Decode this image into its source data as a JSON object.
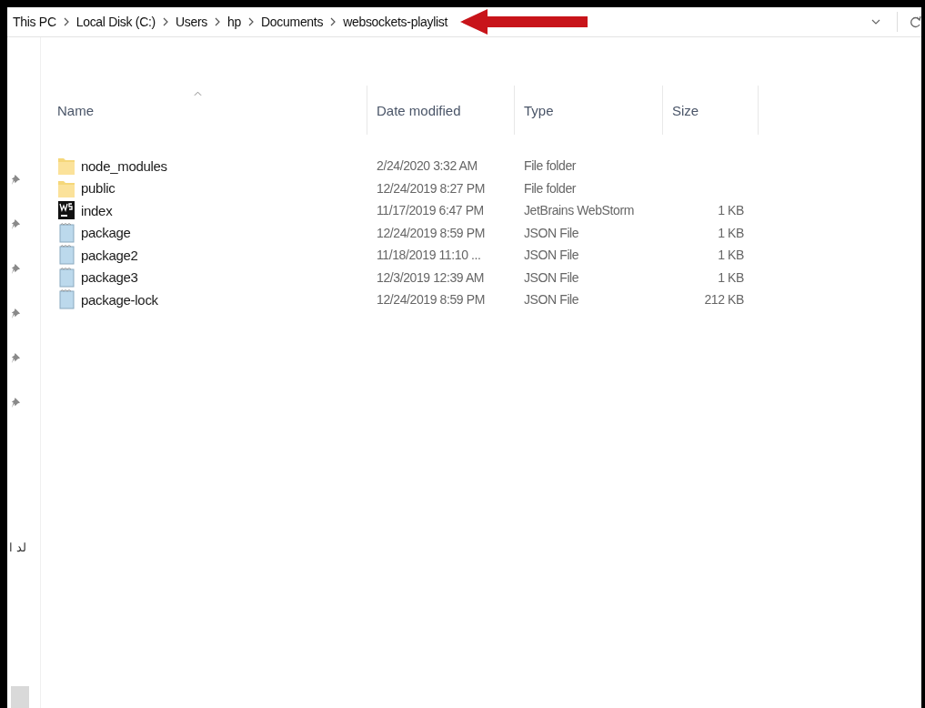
{
  "breadcrumb": [
    "This PC",
    "Local Disk (C:)",
    "Users",
    "hp",
    "Documents",
    "websockets-playlist"
  ],
  "columns": [
    "Name",
    "Date modified",
    "Type",
    "Size"
  ],
  "files": [
    {
      "kind": "folder",
      "name": "node_modules",
      "date": "2/24/2020 3:32 AM",
      "type": "File folder"
    },
    {
      "kind": "folder",
      "name": "public",
      "date": "12/24/2019 8:27 PM",
      "type": "File folder"
    },
    {
      "kind": "webstorm",
      "name": "index",
      "date": "11/17/2019 6:47 PM",
      "type": "JetBrains WebStorm",
      "size": "1 KB"
    },
    {
      "kind": "json",
      "name": "package",
      "date": "12/24/2019 8:59 PM",
      "type": "JSON File",
      "size": "1 KB"
    },
    {
      "kind": "json",
      "name": "package2",
      "date": "11/18/2019 11:10 ...",
      "type": "JSON File",
      "size": "1 KB"
    },
    {
      "kind": "json",
      "name": "package3",
      "date": "12/3/2019 12:39 AM",
      "type": "JSON File",
      "size": "1 KB"
    },
    {
      "kind": "json",
      "name": "package-lock",
      "date": "12/24/2019 8:59 PM",
      "type": "JSON File",
      "size": "212 KB"
    }
  ],
  "nav_pane": {
    "items": [
      {
        "pinned": true
      },
      {
        "pinned": true
      },
      {
        "pinned": true
      },
      {
        "pinned": true
      },
      {
        "pinned": true
      },
      {
        "pinned": true
      }
    ],
    "label": "لد ا"
  }
}
